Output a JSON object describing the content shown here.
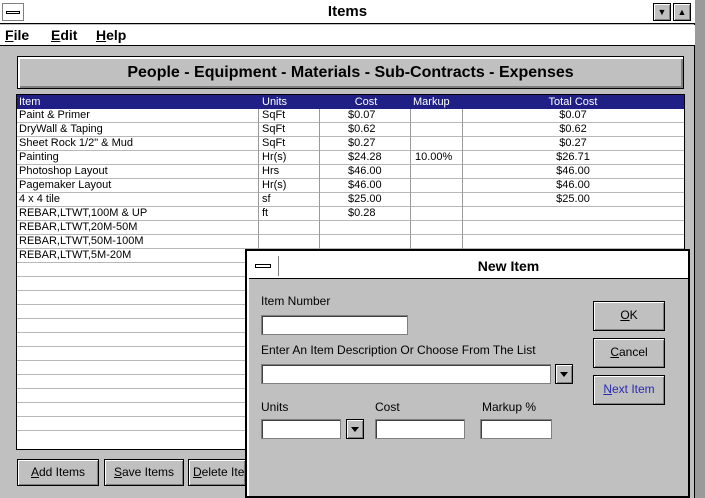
{
  "window": {
    "title": "Items"
  },
  "menu": [
    {
      "label": "File",
      "key": "F",
      "rest": "ile"
    },
    {
      "label": "Edit",
      "key": "E",
      "rest": "dit"
    },
    {
      "label": "Help",
      "key": "H",
      "rest": "elp"
    }
  ],
  "banner": "People - Equipment - Materials - Sub-Contracts - Expenses",
  "grid": {
    "columns": [
      "Item",
      "Units",
      "Cost",
      "Markup",
      "Total Cost"
    ],
    "rows": [
      [
        "Paint & Primer",
        "SqFt",
        "$0.07",
        "",
        "$0.07"
      ],
      [
        "DryWall & Taping",
        "SqFt",
        "$0.62",
        "",
        "$0.62"
      ],
      [
        "Sheet Rock 1/2\" & Mud",
        "SqFt",
        "$0.27",
        "",
        "$0.27"
      ],
      [
        "Painting",
        "Hr(s)",
        "$24.28",
        "10.00%",
        "$26.71"
      ],
      [
        "Photoshop Layout",
        "Hrs",
        "$46.00",
        "",
        "$46.00"
      ],
      [
        "Pagemaker Layout",
        "Hr(s)",
        "$46.00",
        "",
        "$46.00"
      ],
      [
        "4 x 4 tile",
        "sf",
        "$25.00",
        "",
        "$25.00"
      ],
      [
        "REBAR,LTWT,100M & UP",
        "ft",
        "$0.28",
        "",
        ""
      ],
      [
        "REBAR,LTWT,20M-50M",
        "",
        "",
        "",
        ""
      ],
      [
        "REBAR,LTWT,50M-100M",
        "",
        "",
        "",
        ""
      ],
      [
        "REBAR,LTWT,5M-20M",
        "",
        "",
        "",
        ""
      ]
    ],
    "empty_rows": 12
  },
  "buttons": {
    "add": {
      "key": "A",
      "rest": "dd Items"
    },
    "save": {
      "key": "S",
      "rest": "ave Items"
    },
    "delete": {
      "key": "D",
      "rest": "elete Ite"
    }
  },
  "dialog": {
    "title": "New Item",
    "item_number_label": "Item Number",
    "item_number_value": "",
    "description_label": "Enter An Item Description Or Choose From The List",
    "description_value": "",
    "units_label": "Units",
    "units_value": "",
    "cost_label": "Cost",
    "cost_value": "",
    "markup_label": "Markup %",
    "markup_value": "",
    "ok": {
      "key": "O",
      "rest": "K"
    },
    "cancel": {
      "key": "C",
      "rest": "ancel"
    },
    "next": {
      "key": "N",
      "rest": "ext Item"
    }
  },
  "colors": {
    "header_bg": "#1f1f86",
    "face": "#c0c0c0",
    "next_item_text": "#2b2bb0"
  }
}
